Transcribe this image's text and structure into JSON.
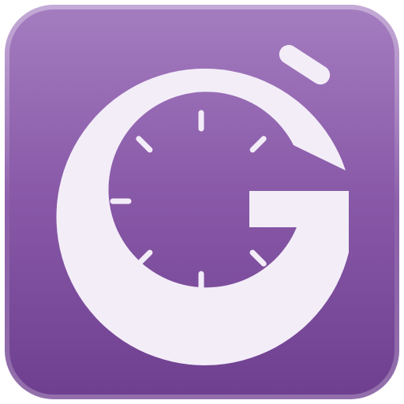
{
  "app_icon": {
    "icon_name": "stopwatch-g-icon",
    "colors": {
      "tile_light": "#a47dc0",
      "tile_mid": "#8a5ba9",
      "tile_dark": "#6e3f8f",
      "glyph": "#f3edf8",
      "tick": "#f3edf8"
    }
  }
}
